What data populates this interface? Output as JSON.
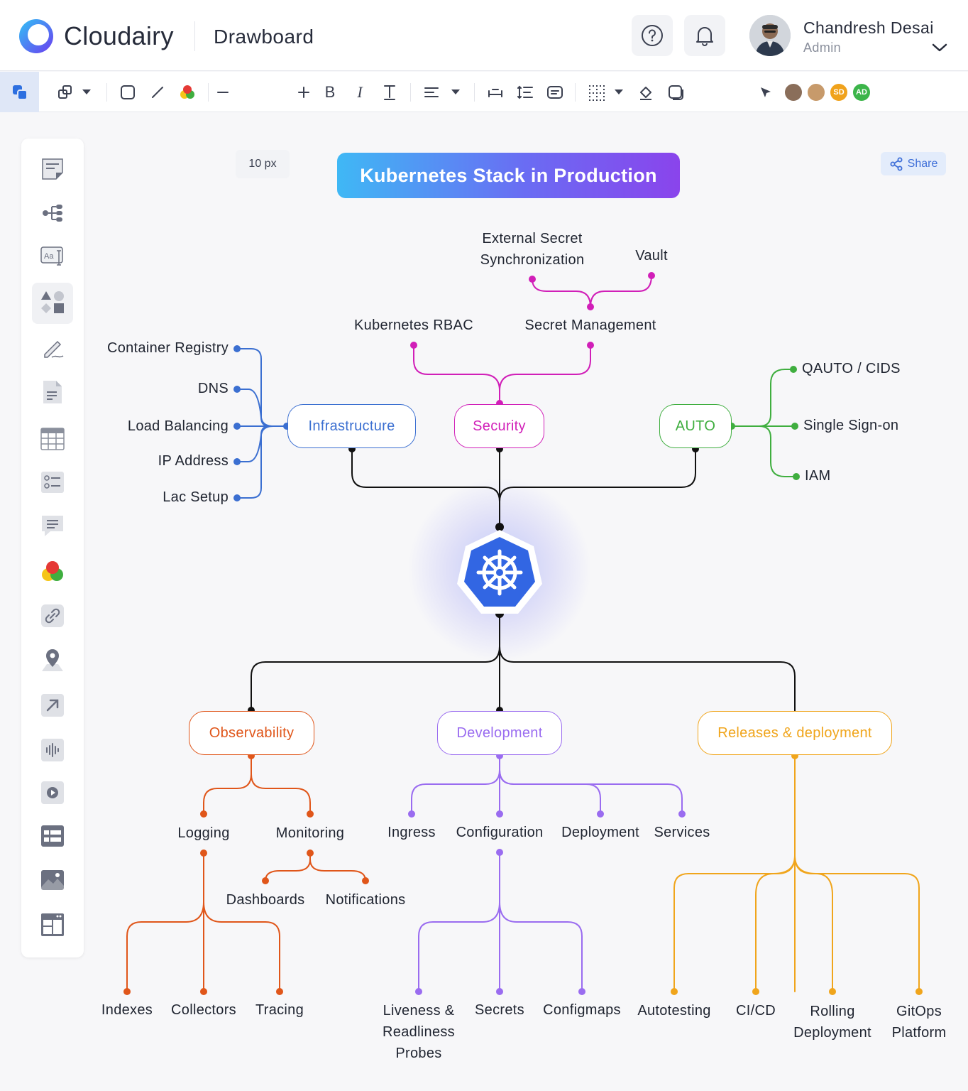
{
  "header": {
    "brand": "Cloudairy",
    "app_name": "Drawboard",
    "user_name": "Chandresh Desai",
    "user_role": "Admin"
  },
  "toolbar": {
    "font_size": "10 px",
    "share_label": "Share",
    "collaborators": [
      {
        "initials": "",
        "color": "#8a6e5a"
      },
      {
        "initials": "",
        "color": "#c79a6b"
      },
      {
        "initials": "SD",
        "color": "#f0a21c"
      },
      {
        "initials": "AD",
        "color": "#3cb54a"
      }
    ]
  },
  "left_panel": {
    "tools": [
      "sticky-note-icon",
      "mindmap-icon",
      "text-icon",
      "shapes-icon",
      "pen-icon",
      "document-icon",
      "table-icon",
      "checklist-icon",
      "comment-icon",
      "color-icon",
      "link-icon",
      "location-icon",
      "arrow-icon",
      "audio-icon",
      "video-icon",
      "layout-list-icon",
      "image-icon",
      "template-icon"
    ]
  },
  "diagram": {
    "title": "Kubernetes Stack in Production",
    "nodes": {
      "infrastructure": "Infrastructure",
      "security": "Security",
      "auto": "AUTO",
      "observability": "Observability",
      "development": "Development",
      "releases": "Releases & deployment"
    },
    "infrastructure_items": [
      "Container Registry",
      "DNS",
      "Load Balancing",
      "IP Address",
      "Lac Setup"
    ],
    "security_items": {
      "rbac": "Kubernetes RBAC",
      "secret_mgmt": "Secret Management",
      "ext_secret_1": "External Secret",
      "ext_secret_2": "Synchronization",
      "vault": "Vault"
    },
    "auto_items": [
      "QAUTO / CIDS",
      "Single Sign-on",
      "IAM"
    ],
    "observability_items": {
      "logging": "Logging",
      "monitoring": "Monitoring",
      "dashboards": "Dashboards",
      "notifications": "Notifications",
      "indexes": "Indexes",
      "collectors": "Collectors",
      "tracing": "Tracing"
    },
    "development_items": {
      "ingress": "Ingress",
      "configuration": "Configuration",
      "deployment": "Deployment",
      "services": "Services",
      "liveness_1": "Liveness &",
      "liveness_2": "Readliness",
      "liveness_3": "Probes",
      "secrets": "Secrets",
      "configmaps": "Configmaps"
    },
    "releases_items": {
      "autotesting": "Autotesting",
      "cicd": "CI/CD",
      "rolling_1": "Rolling",
      "rolling_2": "Deployment",
      "gitops_1": "GitOps",
      "gitops_2": "Platform"
    },
    "colors": {
      "infrastructure": "#3b6fd1",
      "security": "#d11fb8",
      "auto": "#3fae3f",
      "observability": "#e0561a",
      "development": "#9a6cf0",
      "releases": "#f0a51c",
      "trunk": "#111111"
    }
  }
}
